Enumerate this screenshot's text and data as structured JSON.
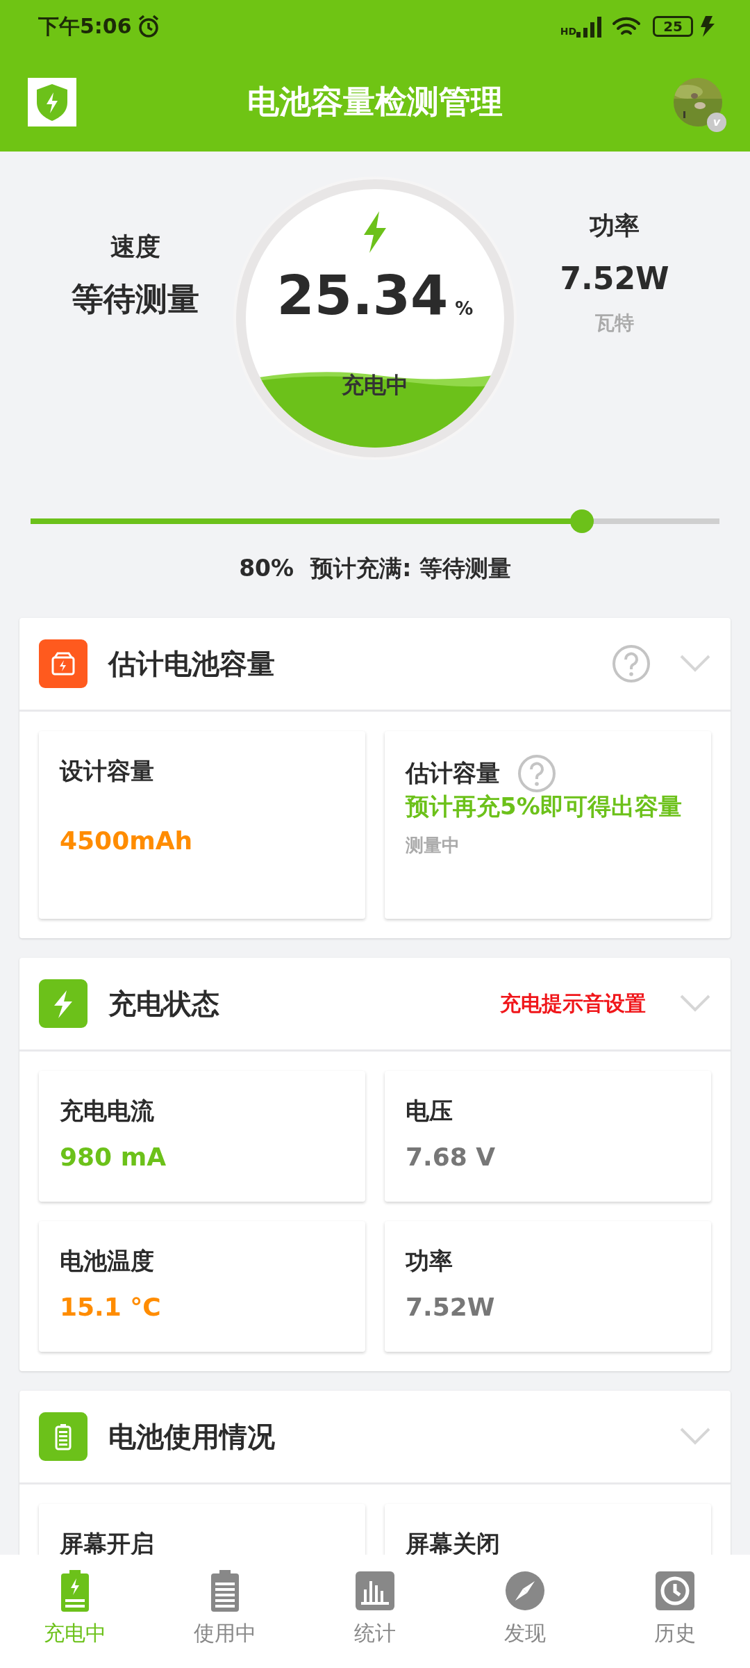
{
  "status_bar": {
    "time": "下午5:06",
    "network": "HD",
    "battery": "25"
  },
  "app_bar": {
    "title": "电池容量检测管理",
    "avatar_badge": "v"
  },
  "gauge": {
    "left": {
      "label": "速度",
      "value": "等待测量"
    },
    "center": {
      "percent": "25.34",
      "unit": "%",
      "status": "充电中"
    },
    "right": {
      "label": "功率",
      "value": "7.52W",
      "unit": "瓦特"
    }
  },
  "charge_limit": {
    "level": 0.8,
    "reading": "80%",
    "eta": "预计充满: 等待测量"
  },
  "sections": [
    {
      "title": "估计电池容量",
      "color": "#ff5a1e",
      "help": true,
      "expanded": false,
      "tiles": [
        {
          "kind": "value",
          "label": "设计容量",
          "value": "4500mAh",
          "color": "#ff8c00"
        },
        {
          "kind": "estimate",
          "label": "估计容量",
          "value": "预计再充5%即可得出容量",
          "note": "测量中",
          "color": "#6cc11a"
        }
      ]
    },
    {
      "title": "充电状态",
      "color": "#6cc11a",
      "help": false,
      "action": "充电提示音设置",
      "expanded": false,
      "tiles": [
        {
          "kind": "value",
          "label": "充电电流",
          "value": "980 mA",
          "color": "#6cc11a"
        },
        {
          "kind": "value",
          "label": "电压",
          "value": "7.68 V",
          "color": "#777777"
        },
        {
          "kind": "value",
          "label": "电池温度",
          "value": "15.1 °C",
          "color": "#ff8c00"
        },
        {
          "kind": "value",
          "label": "功率",
          "value": "7.52W",
          "color": "#777777"
        }
      ]
    },
    {
      "title": "电池使用情况",
      "color": "#6cc11a",
      "help": false,
      "expanded": false,
      "tiles": [
        {
          "kind": "label",
          "label": "屏幕开启"
        },
        {
          "kind": "label",
          "label": "屏幕关闭"
        }
      ]
    }
  ],
  "bottom_nav": [
    {
      "label": "充电中",
      "selected": true
    },
    {
      "label": "使用中",
      "selected": false
    },
    {
      "label": "统计",
      "selected": false
    },
    {
      "label": "发现",
      "selected": false
    },
    {
      "label": "历史",
      "selected": false
    }
  ]
}
